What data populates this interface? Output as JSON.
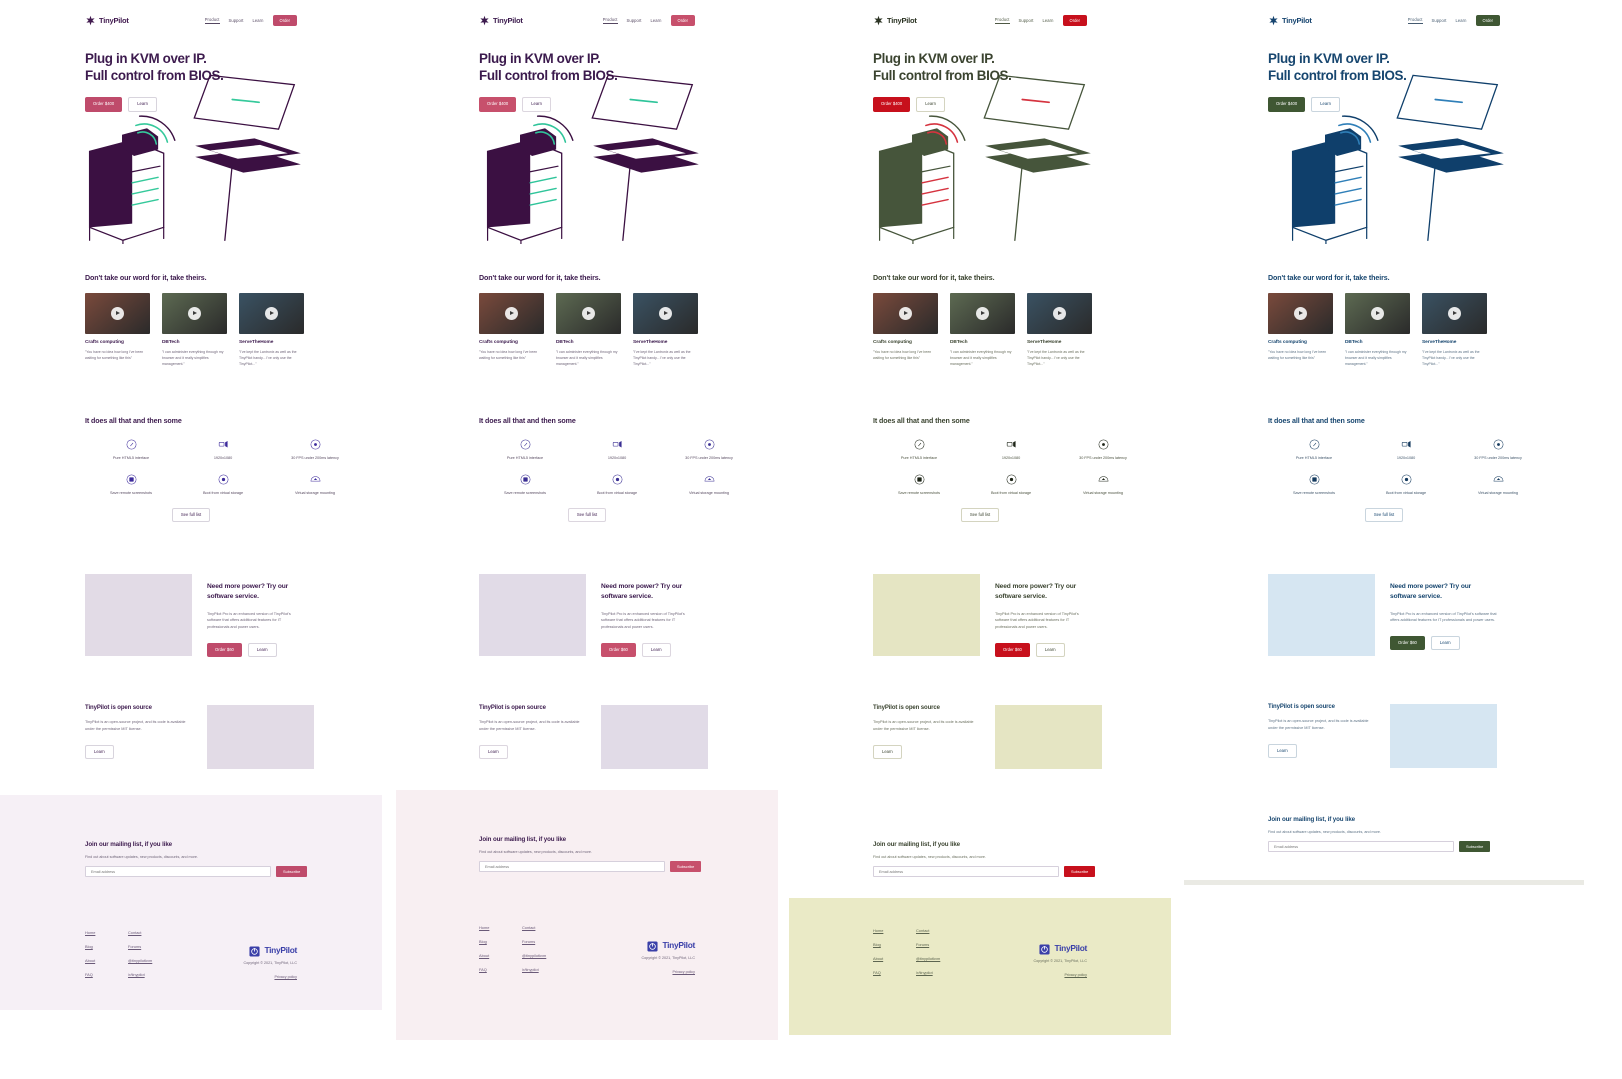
{
  "page": {
    "site_name": "TinyPilot",
    "nav": {
      "links": [
        "Product",
        "Support",
        "Learn"
      ],
      "order_label": "Order"
    },
    "hero": {
      "title_line1": "Plug in KVM over IP.",
      "title_line2": "Full control from BIOS.",
      "primary_label": "Order $400",
      "secondary_label": "Learn"
    },
    "testimonials": {
      "heading": "Don't take our word for it, take theirs.",
      "items": [
        {
          "name": "Crafts computing",
          "quote": "\"You have no idea how long I've been waiting for something like this\"",
          "thumb_color": "#7a4a3c"
        },
        {
          "name": "DBTech",
          "quote": "\"I can administer everything through my browser and it really simplifies management.\"",
          "thumb_color": "#5d6a52"
        },
        {
          "name": "ServeTheHome",
          "quote": "\"I've kept the Lantronix as well as the TinyPilot handy... I've only use the TinyPilot...\"",
          "thumb_color": "#3a5263"
        }
      ]
    },
    "features": {
      "heading": "It does all that and then some",
      "see_full_label": "See full list",
      "items": [
        {
          "label": "Pure HTML5 interface",
          "icon": "cursor-icon"
        },
        {
          "label": "1920x1080",
          "icon": "display-icon"
        },
        {
          "label": "30 FPS under 200ms latency",
          "icon": "gauge-icon"
        },
        {
          "label": "Save remote screenshots",
          "icon": "camera-icon"
        },
        {
          "label": "Boot from virtual storage",
          "icon": "disk-icon"
        },
        {
          "label": "Virtual storage mounting",
          "icon": "upload-icon"
        }
      ]
    },
    "pro": {
      "heading_line1": "Need more power? Try our",
      "heading_line2": "software service.",
      "body": "TinyPilot Pro is an enhanced version of TinyPilot's software that offers additional features for IT professionals and power users.",
      "primary_label": "Order $60",
      "secondary_label": "Learn"
    },
    "open_source": {
      "heading": "TinyPilot is open source",
      "body": "TinyPilot is an open-source project, and its code is available under the permissive MIT license.",
      "learn_label": "Learn"
    },
    "mailing": {
      "heading": "Join our mailing list, if you like",
      "body": "Find out about software updates, new products, discounts, and more.",
      "placeholder": "Email address",
      "value": "",
      "subscribe_label": "Subscribe"
    },
    "footer": {
      "col1": [
        "Home",
        "Blog",
        "About",
        "FAQ"
      ],
      "col2": [
        "Contact",
        "Forums",
        "@tinypilotkvm",
        "/r/tinypilot"
      ],
      "copyright": "Copyright © 2021, TinyPilot, LLC",
      "privacy_label": "Privacy policy"
    }
  },
  "variants": [
    {
      "id": "variant-purple",
      "brand": "#411a4f",
      "heading": "#3d1b4e",
      "text": "#5a4d63",
      "muted": "#6f6579",
      "accent": "#bf4b6b",
      "accent_text": "#ffffff",
      "nav_link": "#4b3d58",
      "link": "#6a5a78",
      "hero_accent": "#35c99b",
      "art_solid": "#3b1042",
      "art_line": "#3b1042",
      "icon": "#3c2a9b",
      "placeholder_img": "#e2dbe6",
      "mail_band": "#f6f0f6",
      "footer_band": "#f6f0f6",
      "brand_logo": "#3a3fa8",
      "ghost_border": "#d8d4dd"
    },
    {
      "id": "variant-crimson",
      "brand": "#3b1a4d",
      "heading": "#3b1a4d",
      "text": "#5a4d63",
      "muted": "#6f6579",
      "accent": "#c7506c",
      "accent_text": "#ffffff",
      "nav_link": "#4b3d58",
      "link": "#6a5a78",
      "hero_accent": "#2fc49a",
      "art_solid": "#3b1042",
      "art_line": "#3b1042",
      "icon": "#3a2f93",
      "placeholder_img": "#e1dbe7",
      "mail_band": "#f8eff2",
      "footer_band": "#f8eff2",
      "brand_logo": "#3a3fa8",
      "ghost_border": "#dcd6df"
    },
    {
      "id": "variant-olive",
      "brand": "#2c3424",
      "heading": "#3b4430",
      "text": "#4f5543",
      "muted": "#6a6f5e",
      "accent": "#c7101c",
      "accent_text": "#ffffff",
      "nav_link": "#45503a",
      "link": "#5d6550",
      "hero_accent": "#d5333f",
      "art_solid": "#46553b",
      "art_line": "#46553b",
      "icon": "#1d2417",
      "placeholder_img": "#e5e5c3",
      "mail_band": "#ffffff",
      "footer_band": "#eaeac6",
      "brand_logo": "#3a3fa8",
      "ghost_border": "#d4d4c0"
    },
    {
      "id": "variant-navy",
      "brand": "#16446f",
      "heading": "#17466f",
      "text": "#41566b",
      "muted": "#5d7285",
      "accent": "#3f5733",
      "accent_text": "#ffffff",
      "nav_link": "#3b5268",
      "link": "#4c6277",
      "hero_accent": "#2f7fb8",
      "art_solid": "#0f3f6b",
      "art_line": "#0f3f6b",
      "icon": "#153a5e",
      "placeholder_img": "#d6e6f2",
      "mail_band": "#ffffff",
      "footer_band": "#eaeae4",
      "brand_logo": "#2a5e96",
      "ghost_border": "#c9d5de"
    }
  ]
}
